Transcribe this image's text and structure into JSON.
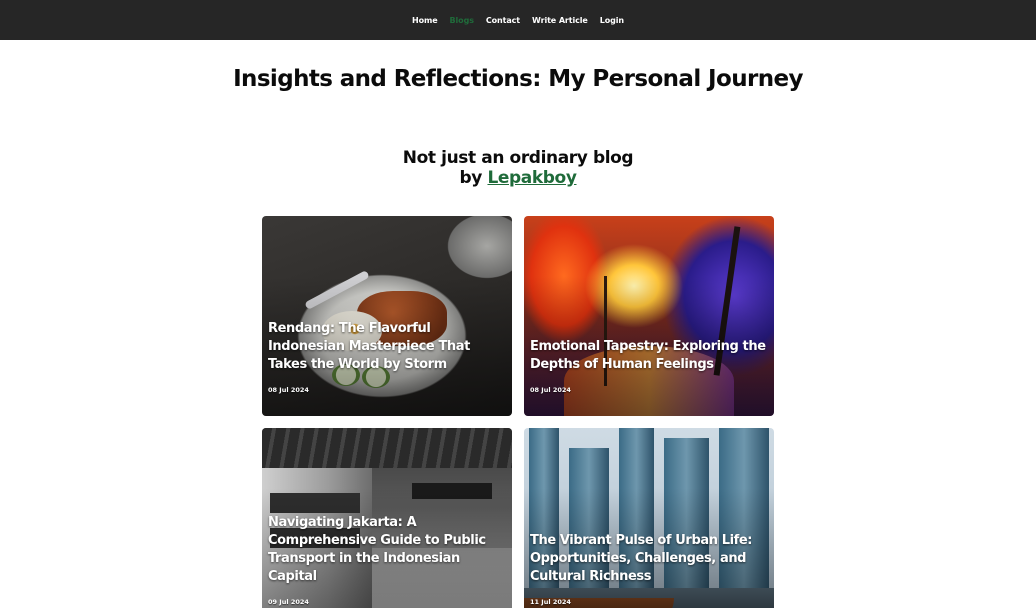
{
  "nav": {
    "items": [
      {
        "label": "Home",
        "active": false
      },
      {
        "label": "Blogs",
        "active": true
      },
      {
        "label": "Contact",
        "active": false
      },
      {
        "label": "Write Article",
        "active": false
      },
      {
        "label": "Login",
        "active": false
      }
    ]
  },
  "header": {
    "title": "Insights and Reflections: My Personal Journey",
    "tagline_line1": "Not just an ordinary blog",
    "tagline_by": "by",
    "author": "Lepakboy"
  },
  "articles": [
    {
      "title": "Rendang: The Flavorful Indonesian Masterpiece That Takes the World by Storm",
      "date": "08 Jul 2024"
    },
    {
      "title": "Emotional Tapestry: Exploring the Depths of Human Feelings",
      "date": "08 Jul 2024"
    },
    {
      "title": "Navigating Jakarta: A Comprehensive Guide to Public Transport in the Indonesian Capital",
      "date": "09 Jul 2024"
    },
    {
      "title": "The Vibrant Pulse of Urban Life: Opportunities, Challenges, and Cultural Richness",
      "date": "11 Jul 2024"
    }
  ],
  "colors": {
    "nav_bg": "#262626",
    "accent": "#1f6b3a",
    "text": "#0b0b0b"
  }
}
